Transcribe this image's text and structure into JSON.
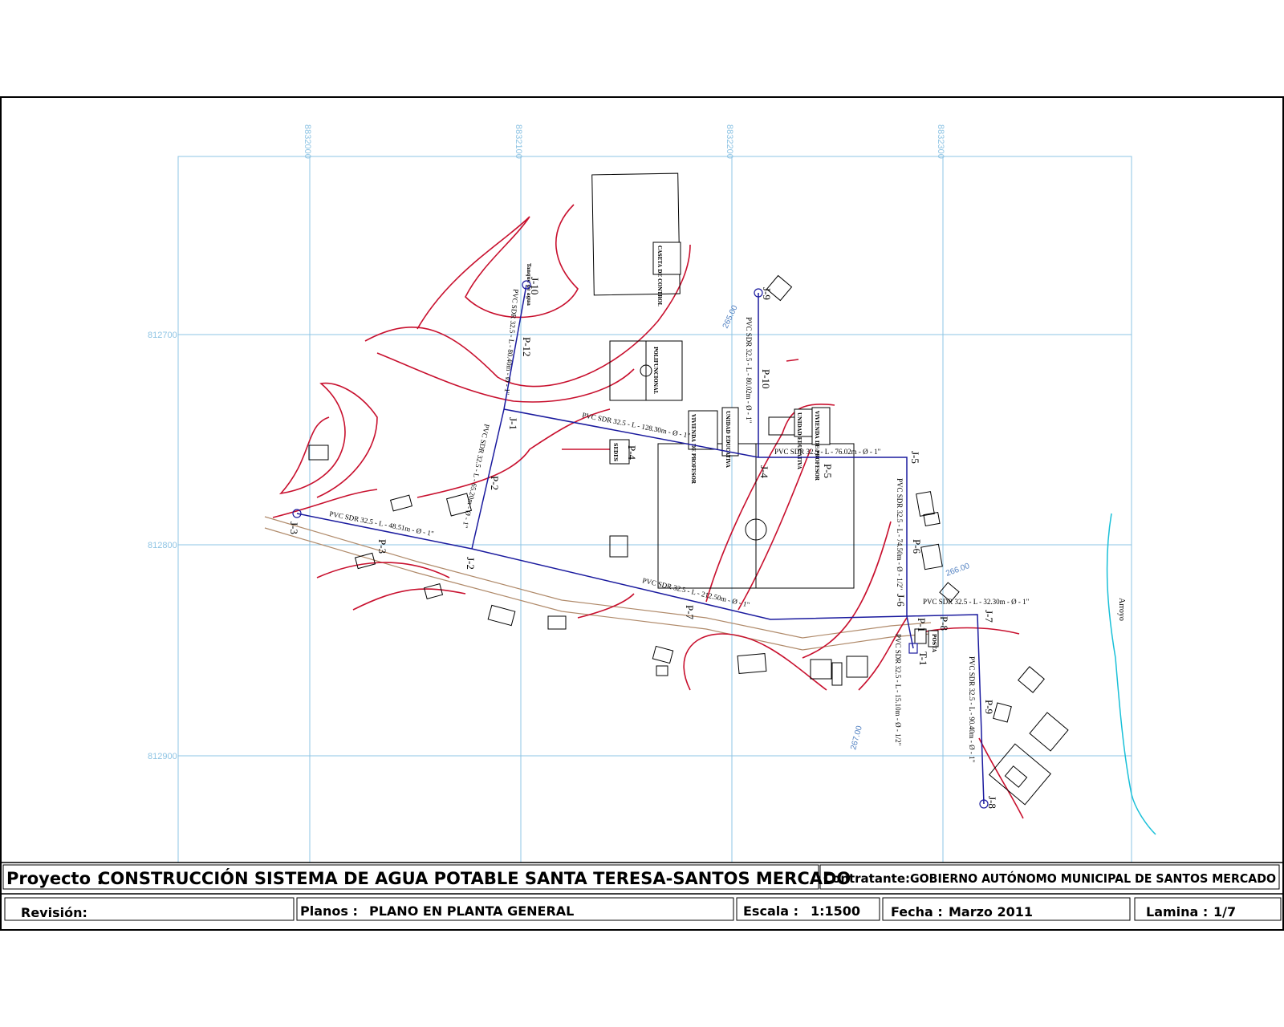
{
  "title_block": {
    "proyecto_label": "Proyecto :",
    "proyecto_value": "CONSTRUCCIÓN SISTEMA DE AGUA POTABLE SANTA TERESA-SANTOS MERCADO",
    "contratante_label": "Contratante:",
    "contratante_value": "GOBIERNO AUTÓNOMO MUNICIPAL DE SANTOS MERCADO",
    "revision_label": "Revisión:",
    "planos_label": "Planos :",
    "planos_value": "PLANO EN PLANTA GENERAL",
    "escala_label": "Escala :",
    "escala_value": "1:1500",
    "fecha_label": "Fecha :",
    "fecha_value": "Marzo 2011",
    "lamina_label": "Lamina :",
    "lamina_value": "1/7"
  },
  "grid": {
    "x_labels": [
      "8832000",
      "8832100",
      "8832200",
      "8832300"
    ],
    "y_labels": [
      "812700",
      "812800",
      "812900"
    ]
  },
  "nodes": [
    "J-1",
    "J-2",
    "J-3",
    "J-4",
    "J-5",
    "J-6",
    "J-7",
    "J-8",
    "J-9",
    "J-10",
    "T-1"
  ],
  "pipes": [
    "P-1",
    "P-2",
    "P-3",
    "P-4",
    "P-5",
    "P-6",
    "P-7",
    "P-8",
    "P-9",
    "P-10",
    "P-12"
  ],
  "pipe_specs": {
    "j1_j4": "PVC SDR 32.5 - L - 128.30m - Ø - 1\"",
    "j3_j2": "PVC SDR 32.5 - L - 48.51m - Ø - 1\"",
    "j2_j6": "PVC SDR 32.5 - L - 212.50m - Ø - 1\"",
    "j4_j5": "PVC SDR 32.5 - L - 76.02m - Ø - 1\"",
    "j6_j7": "PVC SDR 32.5 - L - 32.30m - Ø - 1\"",
    "j5_j6": "PVC SDR 32.5 - L - 74.50m - Ø - 1/2\"",
    "t1": "PVC SDR 32.5 - L - 15.10m - Ø - 1/2\"",
    "j7_j8": "PVC SDR 32.5 - L - 90.40m - Ø - 1\"",
    "j10_j1": "PVC SDR 32.5 - L - 80.40m - Ø - 1\"",
    "j9_j4": "PVC SDR 32.5 - L - 80.02m - Ø - 1\"",
    "j1_j2": "PVC SDR 32.5 - L - 65.20m - Ø - 1\""
  },
  "buildings": {
    "caseta": "CASETA DE CONTROL",
    "polifuncional": "POLIFUNCIONAL",
    "vivienda1": "VIVIENDA DE PROFESOR",
    "unidad1": "UNIDAD EDUCATIVA",
    "unidad2": "UNIDAD EDUCATIVA",
    "vivienda2": "VIVIENDA DE PROFESOR",
    "sedes": "SEDES",
    "tanque": "Tanque de agua",
    "posta": "POSTA"
  },
  "contours": [
    "265.00",
    "266.00",
    "267.00"
  ],
  "arroyo": "Arroyo",
  "colors": {
    "grid": "#8ec4e4",
    "pipe": "#1a1a9e",
    "contour": "#c8102e",
    "road": "#b08a6a",
    "stream": "#19c0d8",
    "frame": "#000000"
  }
}
